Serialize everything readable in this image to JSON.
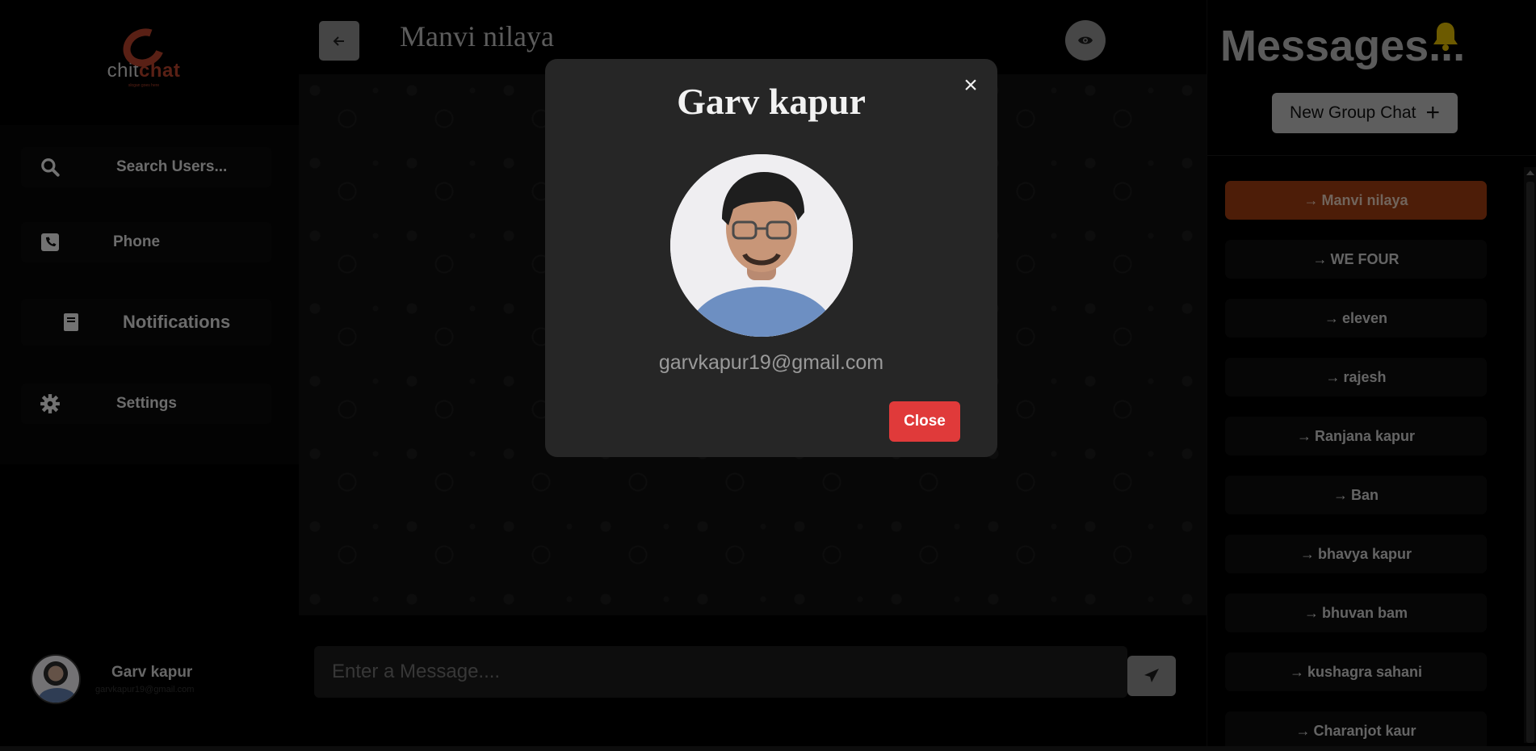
{
  "app": {
    "logo_prefix": "chit",
    "logo_suffix": "chat",
    "slogan": "slogan goes here"
  },
  "sidebar": {
    "search_label": "Search Users...",
    "phone_label": "Phone",
    "notifications_label": "Notifications",
    "settings_label": "Settings",
    "user": {
      "name": "Garv kapur",
      "email": "garvkapur19@gmail.com"
    }
  },
  "chat": {
    "title": "Manvi nilaya",
    "message_placeholder": "Enter a Message...."
  },
  "right_panel": {
    "title": "Messages...",
    "new_group_label": "New Group Chat",
    "chats": [
      {
        "name": "Manvi nilaya",
        "active": true
      },
      {
        "name": "WE FOUR",
        "active": false
      },
      {
        "name": "eleven",
        "active": false
      },
      {
        "name": "rajesh",
        "active": false
      },
      {
        "name": "Ranjana kapur",
        "active": false
      },
      {
        "name": "Ban",
        "active": false
      },
      {
        "name": "bhavya kapur",
        "active": false
      },
      {
        "name": "bhuvan bam",
        "active": false
      },
      {
        "name": "kushagra sahani",
        "active": false
      },
      {
        "name": "Charanjot kaur",
        "active": false
      }
    ]
  },
  "modal": {
    "name": "Garv kapur",
    "email": "garvkapur19@gmail.com",
    "close_label": "Close",
    "close_icon": "×"
  },
  "colors": {
    "accent": "#9a3b11",
    "danger": "#e03a3a",
    "bell": "#d9b400"
  }
}
